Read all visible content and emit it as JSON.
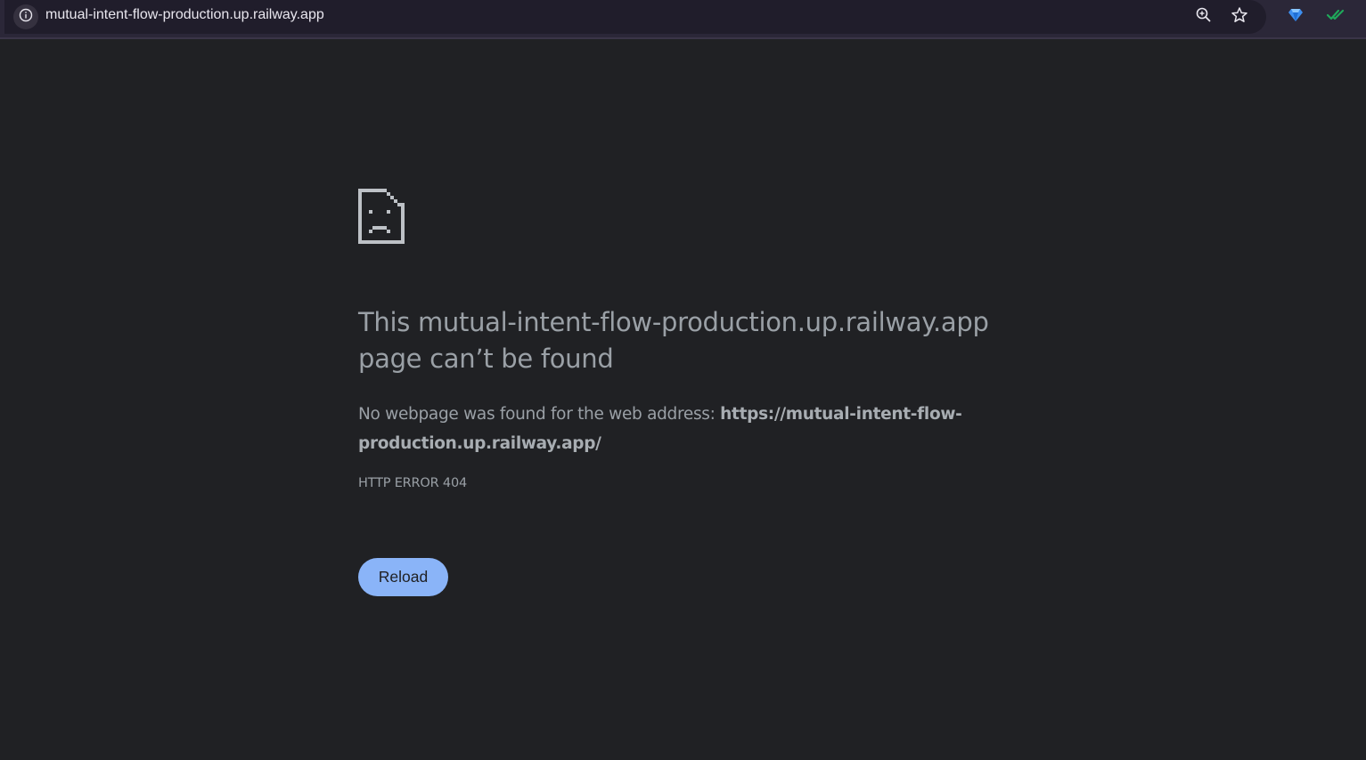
{
  "browser": {
    "url": "mutual-intent-flow-production.up.railway.app",
    "icons": {
      "site_info": "info-icon",
      "zoom": "zoom-in-icon",
      "bookmark": "star-icon",
      "extension_1": "gem-icon",
      "extension_2": "double-check-icon"
    }
  },
  "error_page": {
    "icon": "sad-page-icon",
    "headline_line1": "This mutual-intent-flow-production.up.railway.app",
    "headline_line2": "page can’t be found",
    "desc_prefix": "No webpage was found for the web address: ",
    "desc_url": "https://mutual-intent-flow-production.up.railway.app/",
    "error_code": "HTTP ERROR 404",
    "reload_label": "Reload"
  },
  "colors": {
    "page_background": "#202124",
    "text": "#9aa0a6",
    "button_background": "#8ab4f8",
    "toolbar_background": "#2b2738"
  }
}
